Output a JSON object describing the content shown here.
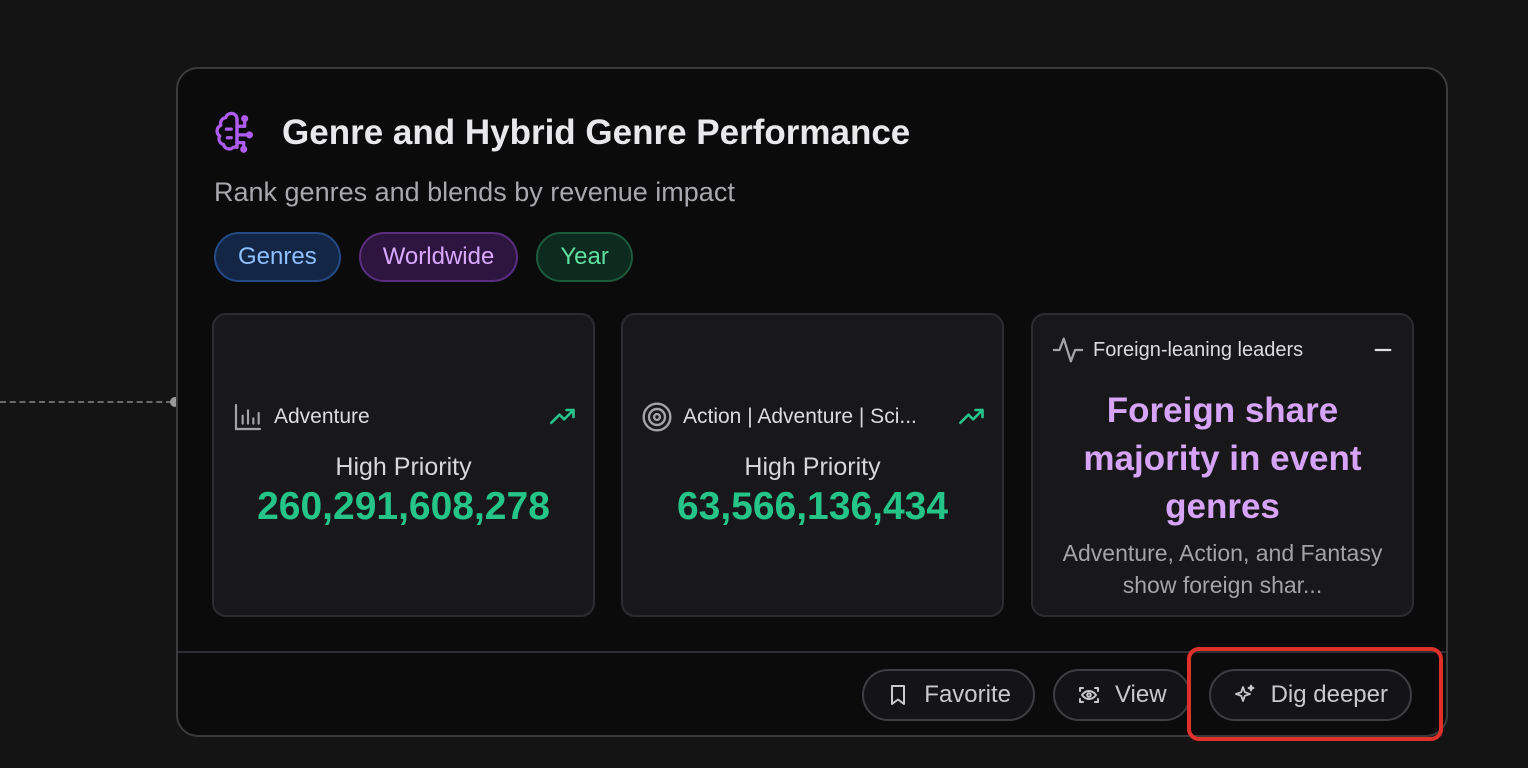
{
  "card": {
    "title": "Genre and Hybrid Genre Performance",
    "subtitle": "Rank genres and blends by revenue impact",
    "title_icon": "brain-icon",
    "tags": [
      {
        "label": "Genres",
        "color": "#8ec0ff"
      },
      {
        "label": "Worldwide",
        "color": "#d9a8ff"
      },
      {
        "label": "Year",
        "color": "#5fe0a0"
      }
    ],
    "tiles": [
      {
        "icon": "bar-chart-icon",
        "label": "Adventure",
        "trend_icon": "trending-up-icon",
        "priority": "High Priority",
        "value": "260,291,608,278"
      },
      {
        "icon": "target-icon",
        "label": "Action | Adventure | Sci...",
        "trend_icon": "trending-up-icon",
        "priority": "High Priority",
        "value": "63,566,136,434"
      }
    ],
    "insight": {
      "icon": "activity-icon",
      "label": "Foreign-leaning leaders",
      "title": "Foreign share majority in event genres",
      "body": "Adventure, Action, and Fantasy show foreign shar..."
    },
    "actions": {
      "favorite": "Favorite",
      "view": "View",
      "dig_deeper": "Dig deeper"
    }
  },
  "colors": {
    "metric_green": "#25c58a",
    "insight_purple": "#d6a3f6",
    "highlight_red": "#e0302a",
    "icon_purple": "#b05cf0"
  }
}
